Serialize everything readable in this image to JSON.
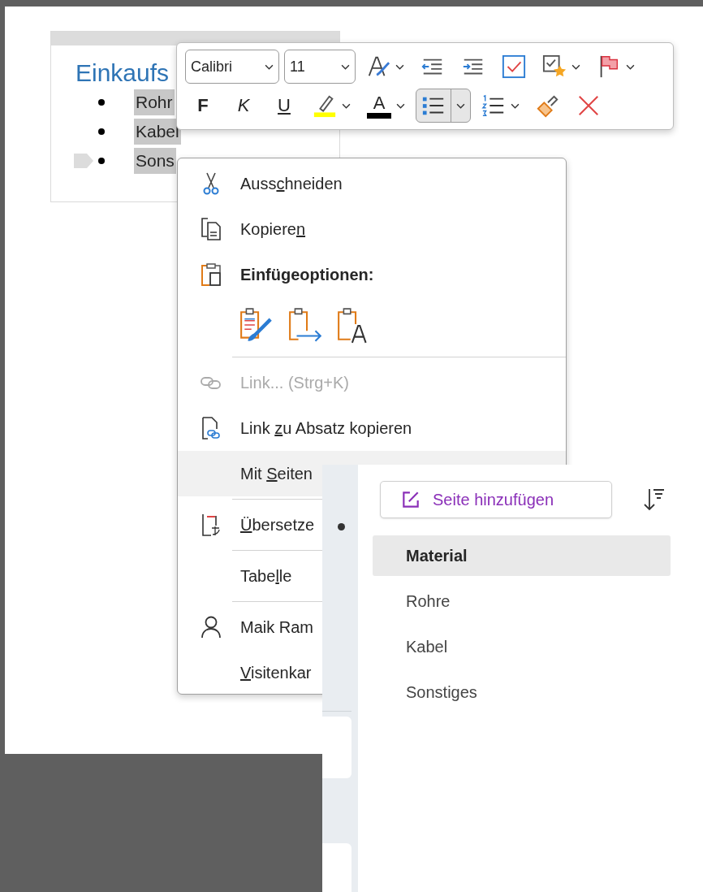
{
  "note": {
    "title": "Einkaufs",
    "bullets": [
      {
        "text": "Rohr",
        "selected": true
      },
      {
        "text": "Kabel",
        "selected": true
      },
      {
        "text": "Sons",
        "selected": true
      }
    ]
  },
  "toolbar": {
    "font": "Calibri",
    "size": "11",
    "row_1": [
      {
        "kind": "fontstyle",
        "dropdown": true,
        "selected": false
      },
      {
        "kind": "outdent",
        "dropdown": false,
        "selected": false
      },
      {
        "kind": "indent",
        "dropdown": false,
        "selected": false
      },
      {
        "kind": "todo",
        "dropdown": false,
        "selected": false
      },
      {
        "kind": "tagstar",
        "dropdown": true,
        "selected": false
      },
      {
        "kind": "flag",
        "dropdown": true,
        "selected": false
      }
    ],
    "row_2": [
      {
        "kind": "bold",
        "label": "F",
        "dropdown": false,
        "selected": false
      },
      {
        "kind": "italic",
        "label": "K",
        "dropdown": false,
        "selected": false
      },
      {
        "kind": "underline",
        "label": "U",
        "dropdown": false,
        "selected": false
      },
      {
        "kind": "highlight",
        "dropdown": true,
        "selected": false
      },
      {
        "kind": "fontcolor",
        "label": "A",
        "dropdown": true,
        "selected": false
      },
      {
        "kind": "bullets",
        "dropdown": true,
        "selected": true
      },
      {
        "kind": "numbering",
        "dropdown": true,
        "selected": false
      },
      {
        "kind": "painter",
        "dropdown": false,
        "selected": false
      },
      {
        "kind": "clear",
        "dropdown": false,
        "selected": false
      }
    ]
  },
  "context_menu": [
    {
      "kind": "cut",
      "before": "Auss",
      "key": "c",
      "after": "hneiden",
      "disabled": false,
      "selected": false
    },
    {
      "kind": "copy",
      "before": "Kopiere",
      "key": "n",
      "disabled": false,
      "selected": false
    },
    {
      "kind": "heading",
      "text": "Einfügeoptionen:"
    },
    {
      "kind": "paste",
      "options": [
        {
          "kind": "format"
        },
        {
          "kind": "merge"
        },
        {
          "kind": "text"
        }
      ]
    },
    {
      "kind": "separator"
    },
    {
      "kind": "link",
      "before": "Link...  (Strg+K)",
      "disabled": true,
      "selected": false
    },
    {
      "kind": "linkpara",
      "before": "Link ",
      "key": "z",
      "after": "u Absatz kopieren",
      "disabled": false,
      "selected": false
    },
    {
      "kind": "plain",
      "before": "Mit ",
      "key": "S",
      "after": "eiten",
      "disabled": false,
      "selected": true
    },
    {
      "kind": "separator"
    },
    {
      "kind": "translate",
      "key": "Ü",
      "after": "bersetze",
      "disabled": false,
      "selected": false
    },
    {
      "kind": "separator"
    },
    {
      "kind": "plain",
      "before": "Tabe",
      "key": "l",
      "after": "le",
      "disabled": false,
      "selected": false
    },
    {
      "kind": "separator"
    },
    {
      "kind": "person",
      "before": "Maik Ram",
      "disabled": false,
      "selected": false
    },
    {
      "kind": "plain",
      "key": "V",
      "after": "isitenkar",
      "disabled": false,
      "selected": false
    }
  ],
  "pages_panel": {
    "add_button": "Seite hinzufügen",
    "pages": [
      {
        "title": "Material",
        "selected": true
      },
      {
        "title": "Rohre",
        "selected": false
      },
      {
        "title": "Kabel",
        "selected": false
      },
      {
        "title": "Sonstiges",
        "selected": false
      }
    ]
  }
}
